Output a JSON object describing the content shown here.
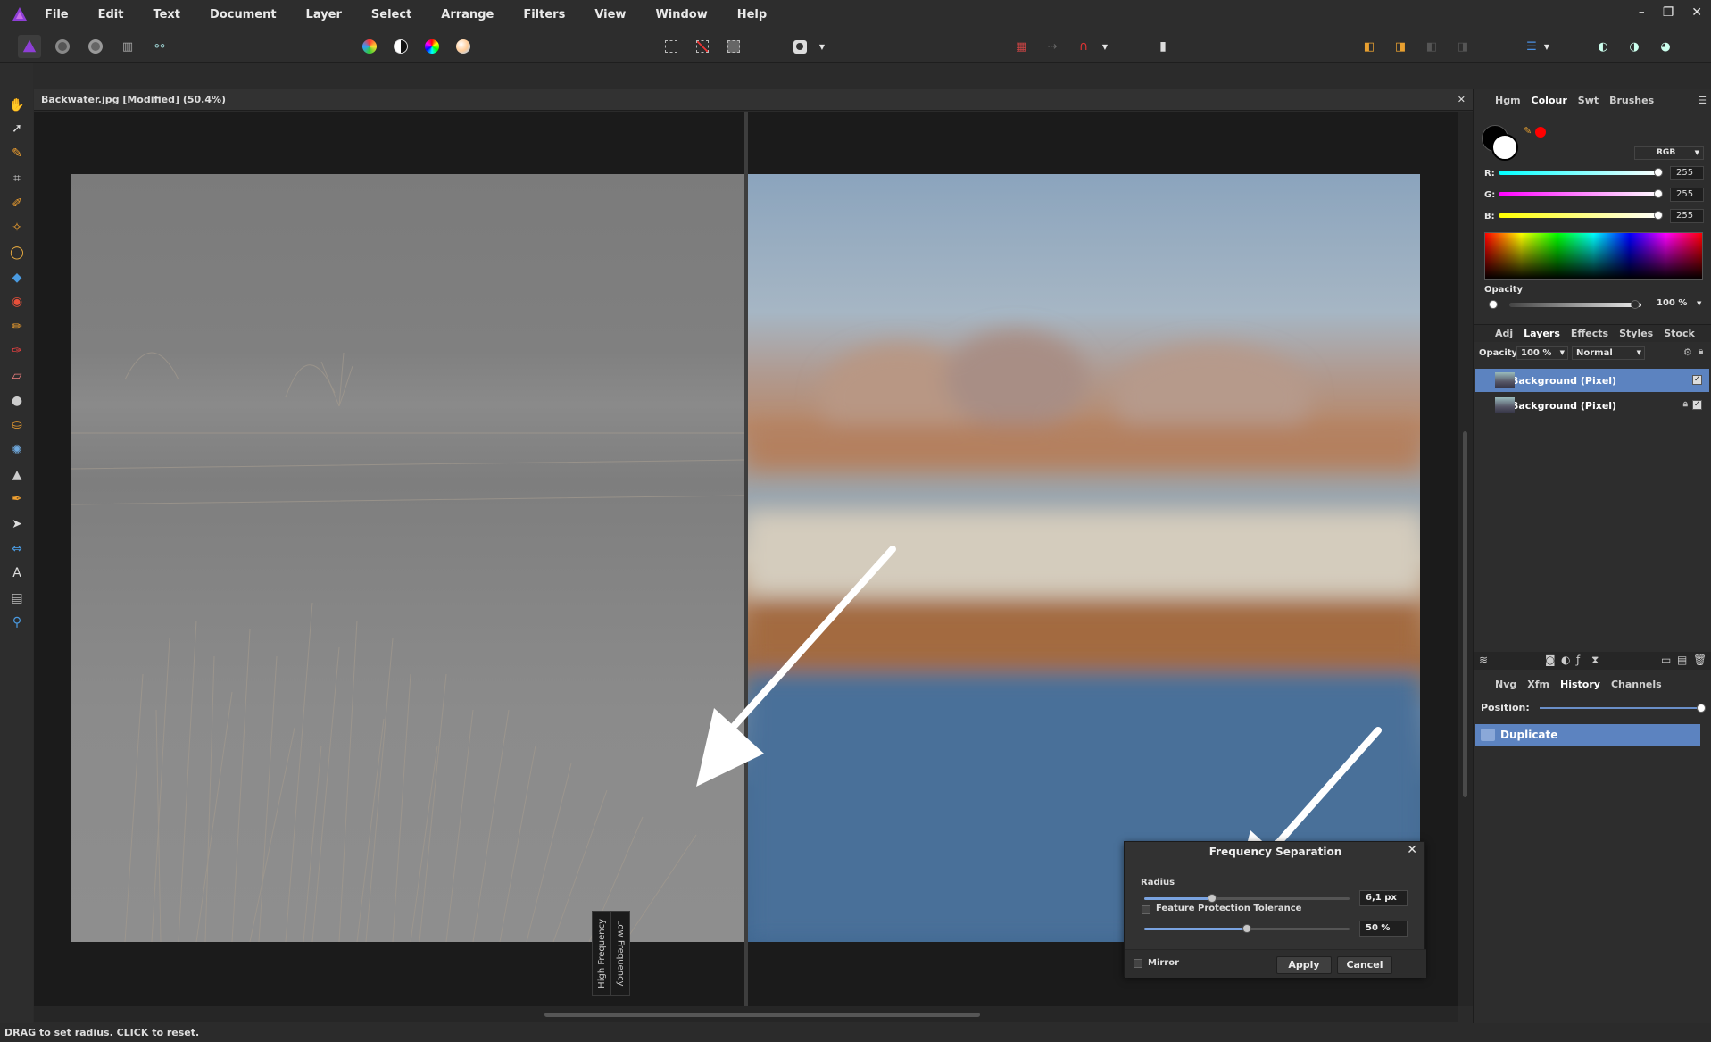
{
  "menu": [
    "File",
    "Edit",
    "Text",
    "Document",
    "Layer",
    "Select",
    "Arrange",
    "Filters",
    "View",
    "Window",
    "Help"
  ],
  "window_controls": {
    "minimize": "–",
    "restore": "❐",
    "close": "✕"
  },
  "document": {
    "title": "Backwater.jpg [Modified] (50.4%)",
    "close": "✕"
  },
  "canvas_labels": {
    "left": "High Frequency",
    "right": "Low Frequency"
  },
  "status_text": "DRAG to set radius. CLICK to reset.",
  "colour_panel": {
    "tabs": [
      "Hgm",
      "Colour",
      "Swt",
      "Brushes"
    ],
    "active_tab": "Colour",
    "mode": "RGB",
    "r_label": "R:",
    "g_label": "G:",
    "b_label": "B:",
    "r": "255",
    "g": "255",
    "b": "255",
    "opacity_label": "Opacity",
    "opacity_value": "100 %",
    "primary_color": "#000000",
    "secondary_color": "#ffffff",
    "accent_dot": "#ff0000"
  },
  "layers_panel": {
    "tabs": [
      "Adj",
      "Layers",
      "Effects",
      "Styles",
      "Stock"
    ],
    "active_tab": "Layers",
    "opacity_label": "Opacity:",
    "opacity_value": "100 %",
    "blend_mode": "Normal",
    "layers": [
      {
        "name": "Background (Pixel)",
        "selected": true,
        "locked": false
      },
      {
        "name": "Background (Pixel)",
        "selected": false,
        "locked": true
      }
    ]
  },
  "history_panel": {
    "tabs": [
      "Nvg",
      "Xfm",
      "History",
      "Channels"
    ],
    "active_tab": "History",
    "position_label": "Position:",
    "items": [
      "Duplicate"
    ]
  },
  "dialog": {
    "title": "Frequency Separation",
    "radius_label": "Radius",
    "radius_value": "6,1 px",
    "radius_fraction": 0.33,
    "fpt_label": "Feature Protection Tolerance",
    "fpt_value": "50 %",
    "fpt_fraction": 0.5,
    "mirror_label": "Mirror",
    "apply": "Apply",
    "cancel": "Cancel",
    "close": "✕"
  },
  "colors": {
    "accent": "#5c83c0",
    "panel": "#2d2d2d",
    "canvas": "#1b1b1b"
  }
}
